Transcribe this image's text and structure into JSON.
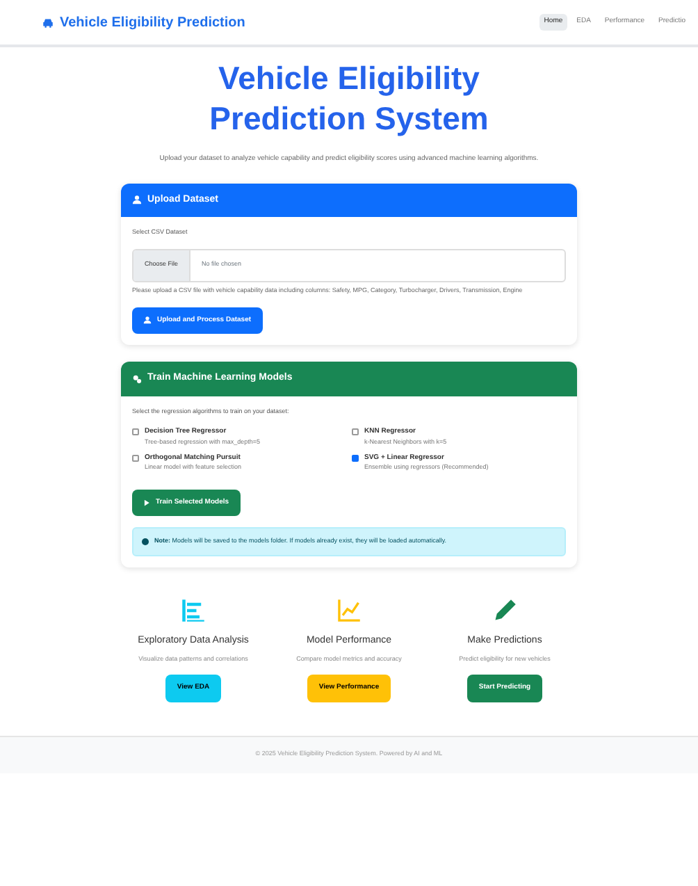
{
  "navbar": {
    "brand": "Vehicle Eligibility Prediction",
    "links": [
      {
        "label": "Home",
        "selected": true
      },
      {
        "label": "EDA",
        "selected": false
      },
      {
        "label": "Performance",
        "selected": false
      },
      {
        "label": "Predictio",
        "selected": false
      }
    ]
  },
  "hero": {
    "title": "Vehicle Eligibility Prediction System",
    "subtitle": "Upload your dataset to analyze vehicle capability and predict eligibility scores using advanced machine learning algorithms."
  },
  "upload_card": {
    "title": "Upload Dataset",
    "field_label": "Select CSV Dataset",
    "file_button": "Choose File",
    "file_status": "No file chosen",
    "help": "Please upload a CSV file with vehicle capability data including columns: Safety, MPG, Category, Turbocharger, Drivers, Transmission, Engine",
    "button": "Upload and Process Dataset"
  },
  "train_card": {
    "title": "Train Machine Learning Models",
    "intro": "Select the regression algorithms to train on your dataset:",
    "models": [
      {
        "name": "Decision Tree Regressor",
        "description": "Tree-based regression with max_depth=5",
        "checked": false
      },
      {
        "name": "KNN Regressor",
        "description": "k-Nearest Neighbors with k=5",
        "checked": false
      },
      {
        "name": "Orthogonal Matching Pursuit",
        "description": "Linear model with feature selection",
        "checked": false
      },
      {
        "name": "SVG + Linear Regressor",
        "description": "Ensemble using regressors (Recommended)",
        "checked": true
      }
    ],
    "button": "Train Selected Models",
    "note": "**Note:** Models will be saved to the models folder. If models already exist, they will be loaded automatically."
  },
  "features": [
    {
      "kind": "eda",
      "title": "Exploratory Data Analysis",
      "description": "Visualize data patterns and correlations",
      "button": "View EDA"
    },
    {
      "kind": "performance",
      "title": "Model Performance",
      "description": "Compare model metrics and accuracy",
      "button": "View Performance"
    },
    {
      "kind": "predict",
      "title": "Make Predictions",
      "description": "Predict eligibility for new vehicles",
      "button": "Start Predicting"
    }
  ],
  "footer": "© 2025 Vehicle Eligibility Prediction System. Powered by AI and ML"
}
